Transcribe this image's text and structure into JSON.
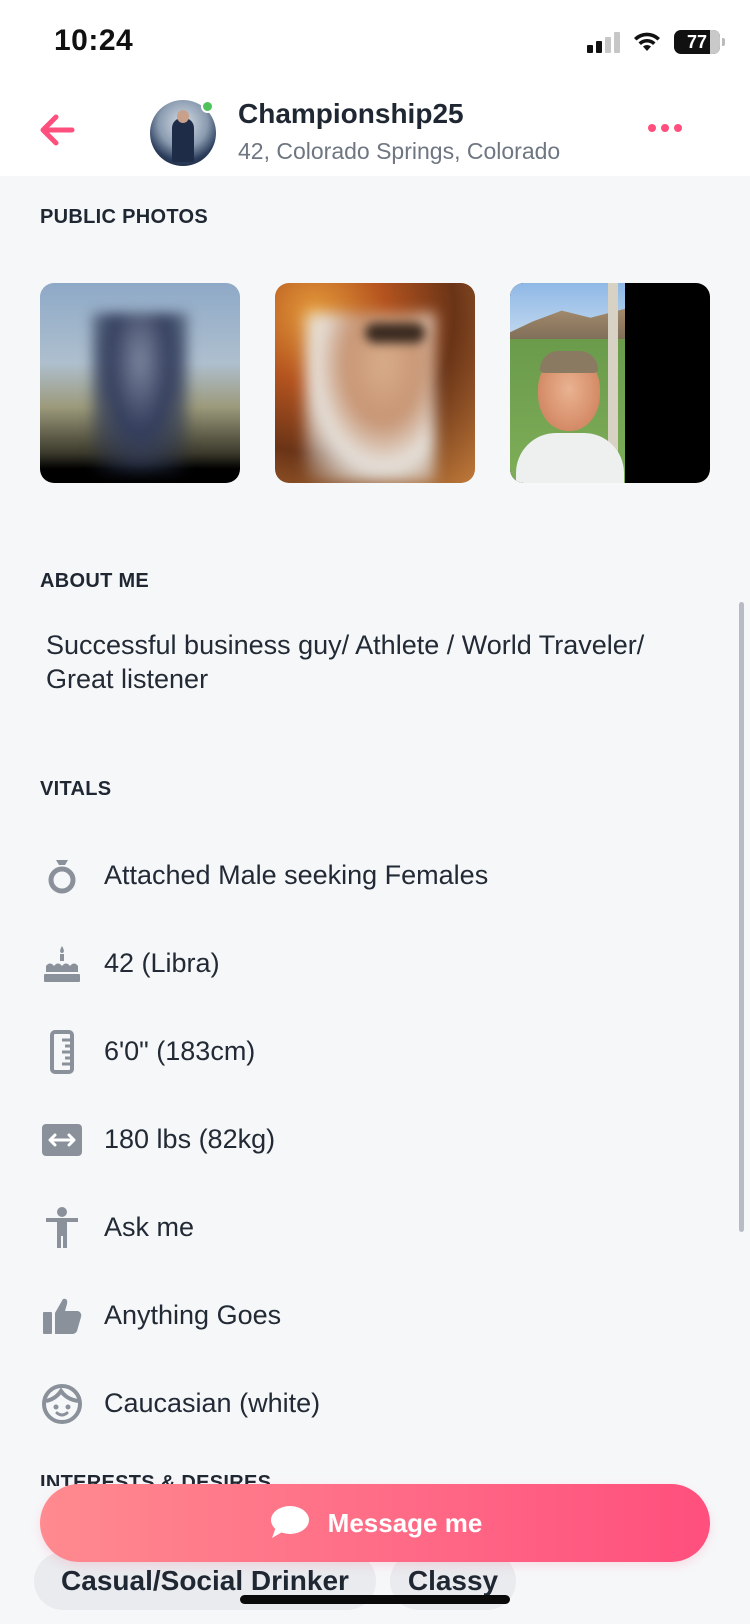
{
  "status_bar": {
    "time": "10:24",
    "battery": "77"
  },
  "header": {
    "username": "Championship25",
    "subline": "42, Colorado Springs, Colorado"
  },
  "sections": {
    "public_photos": "PUBLIC PHOTOS",
    "about_me": "ABOUT ME",
    "vitals": "VITALS",
    "interests": "INTERESTS & DESIRES"
  },
  "about": {
    "text": "Successful business guy/ Athlete / World Traveler/ Great listener"
  },
  "vitals": [
    {
      "icon": "ring-icon",
      "label": "Attached Male seeking Females"
    },
    {
      "icon": "cake-icon",
      "label": "42 (Libra)"
    },
    {
      "icon": "ruler-icon",
      "label": "6'0\" (183cm)"
    },
    {
      "icon": "width-arrows-icon",
      "label": "180 lbs (82kg)"
    },
    {
      "icon": "body-icon",
      "label": "Ask me"
    },
    {
      "icon": "thumbs-up-icon",
      "label": "Anything Goes"
    },
    {
      "icon": "face-icon",
      "label": "Caucasian (white)"
    }
  ],
  "actions": {
    "message_label": "Message me"
  },
  "chips": [
    "Casual/Social Drinker",
    "Classy"
  ],
  "colors": {
    "accent": "#ff4f7d",
    "online": "#4fc35b",
    "icon_gray": "#8a919b"
  }
}
